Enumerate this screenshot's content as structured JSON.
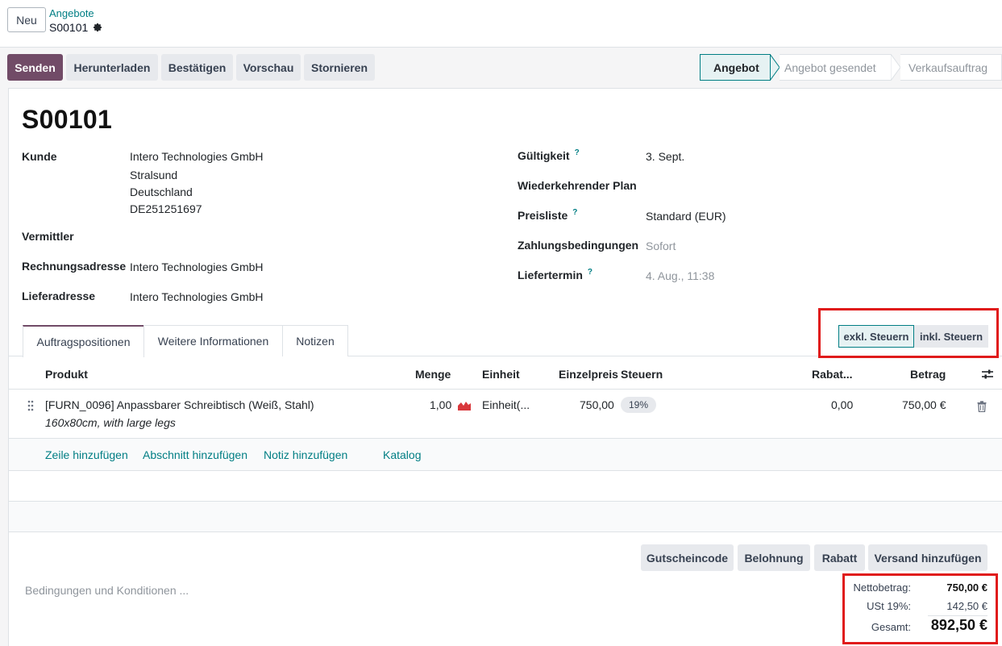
{
  "control_panel": {
    "new_button": "Neu",
    "breadcrumb_parent": "Angebote",
    "breadcrumb_current": "S00101"
  },
  "actions": {
    "send": "Senden",
    "download": "Herunterladen",
    "confirm": "Bestätigen",
    "preview": "Vorschau",
    "cancel": "Stornieren"
  },
  "status": {
    "stages": [
      "Angebot",
      "Angebot gesendet",
      "Verkaufsauftrag"
    ],
    "active": "Angebot"
  },
  "record": {
    "name": "S00101",
    "customer_label": "Kunde",
    "customer_lines": [
      "Intero Technologies GmbH",
      "Stralsund",
      "Deutschland",
      "DE251251697"
    ],
    "referrer_label": "Vermittler",
    "invoice_address_label": "Rechnungsadresse",
    "invoice_address": "Intero Technologies GmbH",
    "delivery_address_label": "Lieferadresse",
    "delivery_address": "Intero Technologies GmbH",
    "validity_label": "Gültigkeit",
    "validity": "3. Sept.",
    "recurring_label": "Wiederkehrender Plan",
    "pricelist_label": "Preisliste",
    "pricelist": "Standard (EUR)",
    "payment_terms_label": "Zahlungsbedingungen",
    "payment_terms": "Sofort",
    "delivery_date_label": "Liefertermin",
    "delivery_date": "4. Aug., 11:38",
    "help_mark": "?"
  },
  "tabs": [
    "Auftragspositionen",
    "Weitere Informationen",
    "Notizen"
  ],
  "tax_toggle": {
    "excl": "exkl. Steuern",
    "incl": "inkl. Steuern",
    "active": "excl"
  },
  "order_lines": {
    "headers": {
      "product": "Produkt",
      "quantity": "Menge",
      "uom": "Einheit",
      "unit_price": "Einzelpreis",
      "taxes": "Steuern",
      "discount": "Rabat...",
      "amount": "Betrag"
    },
    "rows": [
      {
        "product": "[FURN_0096] Anpassbarer Schreibtisch (Weiß, Stahl)",
        "description": "160x80cm, with large legs",
        "quantity": "1,00",
        "uom": "Einheit(...",
        "unit_price": "750,00",
        "tax": "19%",
        "discount": "0,00",
        "amount": "750,00 €"
      }
    ],
    "add_links": {
      "line": "Zeile hinzufügen",
      "section": "Abschnitt hinzufügen",
      "note": "Notiz hinzufügen",
      "catalog": "Katalog"
    }
  },
  "bottom_buttons": {
    "coupon": "Gutscheincode",
    "reward": "Belohnung",
    "discount": "Rabatt",
    "shipping": "Versand hinzufügen"
  },
  "terms_placeholder": "Bedingungen und Konditionen ...",
  "totals": {
    "net_label": "Nettobetrag:",
    "net_value": "750,00 €",
    "tax_label": "USt 19%:",
    "tax_value": "142,50 €",
    "total_label": "Gesamt:",
    "total_value": "892,50 €"
  },
  "colors": {
    "primary": "#714b67",
    "link": "#017e84",
    "highlight": "#e01b1b"
  }
}
